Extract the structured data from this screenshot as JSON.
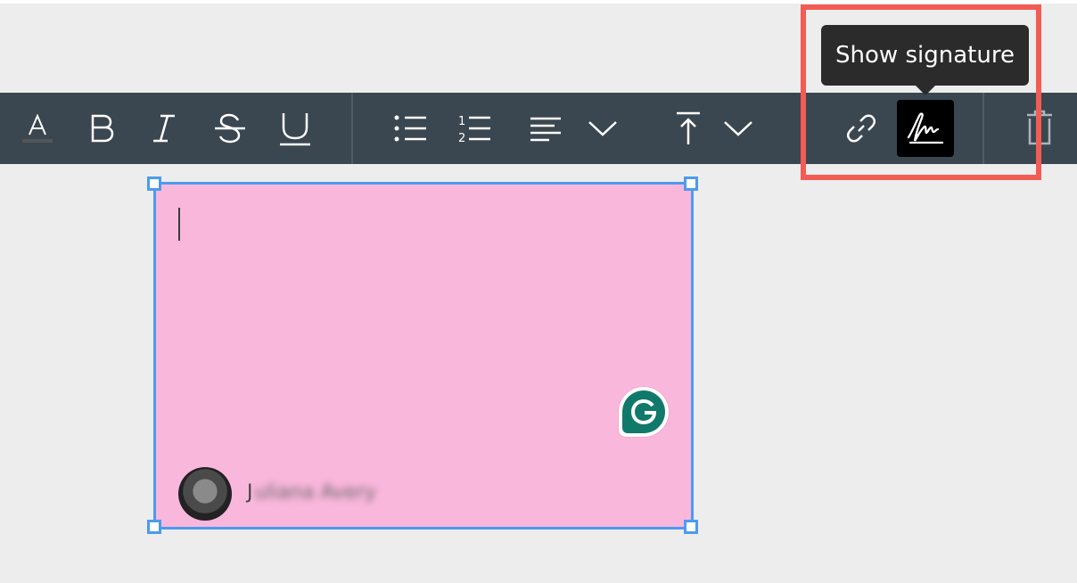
{
  "tooltip": {
    "text": "Show signature"
  },
  "toolbar": {
    "buttons": [
      {
        "name": "text-color",
        "icon": "text-color-icon"
      },
      {
        "name": "bold",
        "icon": "bold-icon"
      },
      {
        "name": "italic",
        "icon": "italic-icon"
      },
      {
        "name": "strikethrough",
        "icon": "strikethrough-icon"
      },
      {
        "name": "underline",
        "icon": "underline-icon"
      },
      {
        "name": "bulleted-list",
        "icon": "bulleted-list-icon"
      },
      {
        "name": "numbered-list",
        "icon": "numbered-list-icon"
      },
      {
        "name": "align",
        "icon": "align-left-icon"
      },
      {
        "name": "vertical-align",
        "icon": "align-top-icon"
      },
      {
        "name": "link",
        "icon": "link-icon"
      },
      {
        "name": "signature",
        "icon": "signature-icon",
        "active": true
      },
      {
        "name": "delete",
        "icon": "trash-icon"
      }
    ],
    "colors": {
      "background": "#3a4650",
      "icon": "#ffffff",
      "active_bg": "#000000"
    }
  },
  "note": {
    "background": "#fab7dc",
    "border_color": "#4c9bef",
    "author": {
      "initial": "J",
      "name_blurred": "uliana Avery"
    }
  },
  "highlight_color": "#f25c54"
}
